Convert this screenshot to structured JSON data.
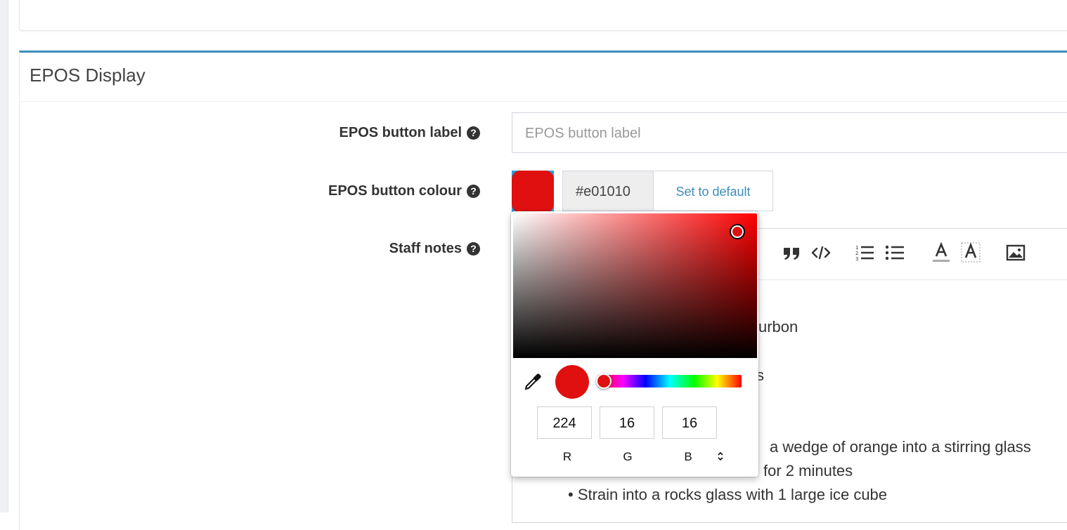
{
  "section": {
    "title": "EPOS Display"
  },
  "fields": {
    "button_label": {
      "label": "EPOS button label",
      "placeholder": "EPOS button label"
    },
    "button_colour": {
      "label": "EPOS button colour",
      "hex_value": "#e01010",
      "default_button": "Set to default",
      "swatch_color": "#e01010"
    },
    "staff_notes": {
      "label": "Staff notes"
    }
  },
  "help_icon_glyph": "?",
  "editor": {
    "toolbar_icons": [
      "blockquote-icon",
      "code-icon",
      "ordered-list-icon",
      "unordered-list-icon",
      "font-color-icon",
      "background-color-icon",
      "image-icon"
    ],
    "visible_lines": [
      "urbon",
      "s",
      "a wedge of orange into a stirring glass",
      "for 2 minutes",
      "• Strain into a rocks glass with 1 large ice cube"
    ]
  },
  "color_picker": {
    "r": "224",
    "g": "16",
    "b": "16",
    "r_label": "R",
    "g_label": "G",
    "b_label": "B",
    "current_color": "#e01010"
  }
}
